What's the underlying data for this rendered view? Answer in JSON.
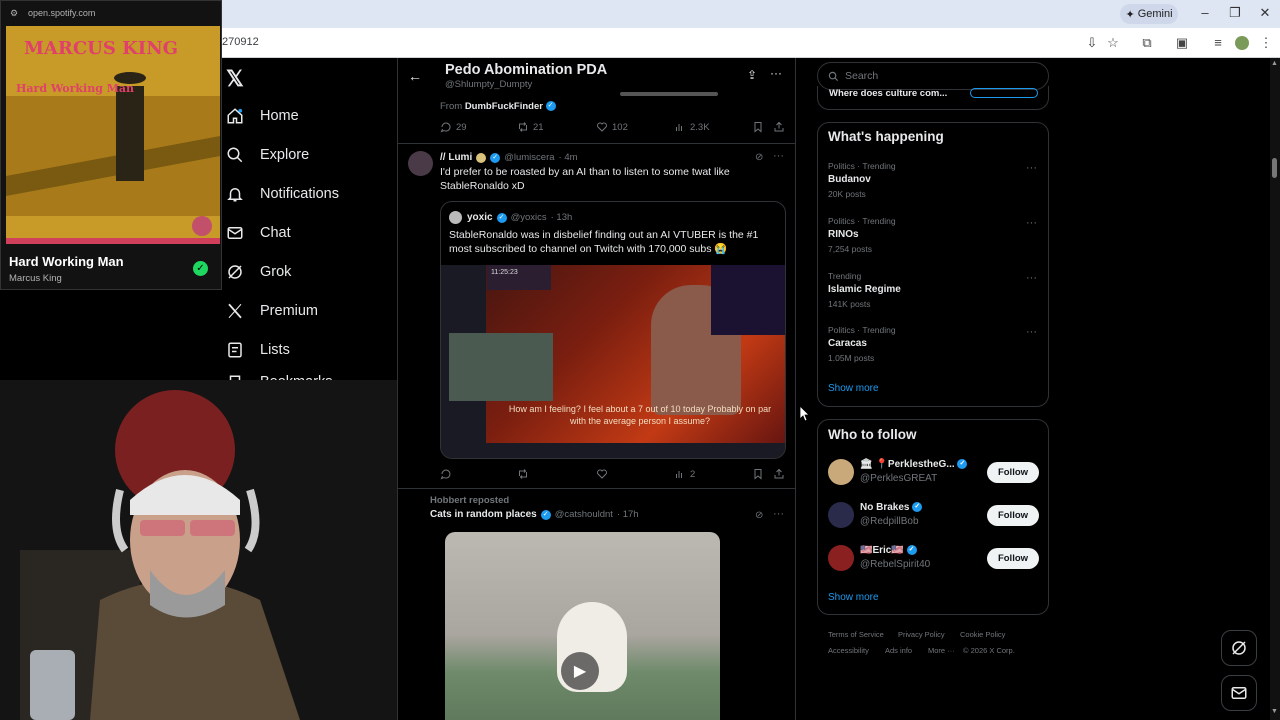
{
  "browser": {
    "url_fragment": "270912",
    "gemini_label": "Gemini"
  },
  "spotify": {
    "url": "open.spotify.com",
    "song": "Hard Working Man",
    "artist": "Marcus King",
    "album_artist_text": "MARCUS KING",
    "album_title_text": "Hard Working Man"
  },
  "nav": {
    "items": [
      {
        "label": "Home",
        "icon": "home-icon"
      },
      {
        "label": "Explore",
        "icon": "search-icon"
      },
      {
        "label": "Notifications",
        "icon": "bell-icon"
      },
      {
        "label": "Chat",
        "icon": "mail-icon"
      },
      {
        "label": "Grok",
        "icon": "grok-icon"
      },
      {
        "label": "Premium",
        "icon": "x-icon"
      },
      {
        "label": "Lists",
        "icon": "list-icon"
      },
      {
        "label": "Bookmarks",
        "icon": "bookmark-icon"
      }
    ]
  },
  "header": {
    "title": "Pedo Abomination PDA",
    "handle": "@Shlumpty_Dumpty"
  },
  "tweet1": {
    "from_prefix": "From",
    "from_name": "DumbFuckFinder",
    "replies": "29",
    "reposts": "21",
    "likes": "102",
    "views": "2.3K"
  },
  "tweet2": {
    "name": "// Lumi",
    "handle": "@lumiscera",
    "time": "· 4m",
    "text": "I'd prefer to be roasted by an AI than to listen to some twat like StableRonaldo xD",
    "quote": {
      "name": "yoxic",
      "handle": "@yoxics",
      "time": "· 13h",
      "text": "StableRonaldo was in disbelief finding out an AI VTUBER is the #1 most subscribed to channel on Twitch with 170,000 subs 😭",
      "caption": "How am I feeling? I feel about a 7 out of 10 today Probably on par with the average person I assume?",
      "timer": "11:25:23"
    },
    "views": "2"
  },
  "tweet3": {
    "repost_by": "Hobbert reposted",
    "name": "Cats in random places",
    "handle": "@catshouldnt",
    "time": "· 17h"
  },
  "sidebar": {
    "search_placeholder": "Search",
    "prev_panel_text": "Where does culture com...",
    "happening_title": "What's happening",
    "trends": [
      {
        "category": "Politics · Trending",
        "name": "Budanov",
        "posts": "20K posts"
      },
      {
        "category": "Politics · Trending",
        "name": "RINOs",
        "posts": "7,254 posts"
      },
      {
        "category": "Trending",
        "name": "Islamic Regime",
        "posts": "141K posts"
      },
      {
        "category": "Politics · Trending",
        "name": "Caracas",
        "posts": "1.05M posts"
      }
    ],
    "show_more": "Show more",
    "who_title": "Who to follow",
    "follows": [
      {
        "name": "🏛 📍PerklestheG...",
        "handle": "@PerklesGREAT",
        "button": "Follow"
      },
      {
        "name": "No Brakes",
        "handle": "@RedpillBob",
        "button": "Follow"
      },
      {
        "name": "🇺🇸Eric🇺🇸",
        "handle": "@RebelSpirit40",
        "button": "Follow"
      }
    ],
    "footer": [
      "Terms of Service",
      "Privacy Policy",
      "Cookie Policy",
      "Accessibility",
      "Ads info",
      "More ···",
      "© 2026 X Corp."
    ]
  },
  "colors": {
    "accent": "#1d9bf0",
    "spotify_green": "#1ed760",
    "border": "#2f3336"
  }
}
